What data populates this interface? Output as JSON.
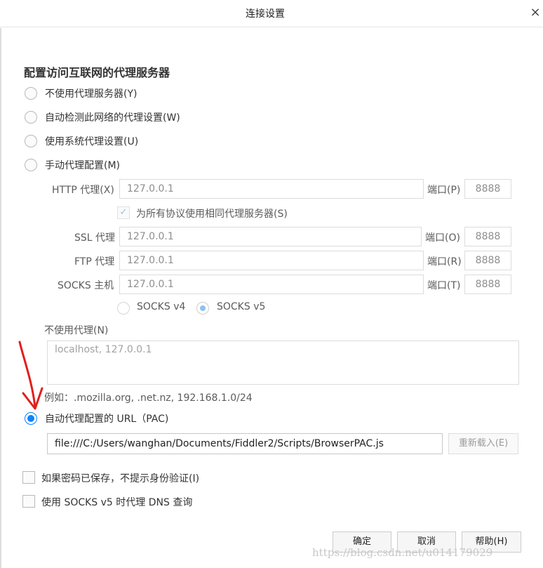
{
  "window": {
    "title": "连接设置",
    "close_glyph": "×"
  },
  "section_title": "配置访问互联网的代理服务器",
  "proxy_options": [
    {
      "label": "不使用代理服务器(Y)",
      "selected": false
    },
    {
      "label": "自动检测此网络的代理设置(W)",
      "selected": false
    },
    {
      "label": "使用系统代理设置(U)",
      "selected": false
    },
    {
      "label": "手动代理配置(M)",
      "selected": false
    },
    {
      "label": "自动代理配置的 URL（PAC)",
      "selected": true
    }
  ],
  "manual": {
    "http": {
      "label": "HTTP 代理(X)",
      "value": "127.0.0.1",
      "port_label": "端口(P)",
      "port": "8888"
    },
    "same_for_all": {
      "label": "为所有协议使用相同代理服务器(S)",
      "checked": true
    },
    "ssl": {
      "label": "SSL 代理",
      "value": "127.0.0.1",
      "port_label": "端口(O)",
      "port": "8888"
    },
    "ftp": {
      "label": "FTP 代理",
      "value": "127.0.0.1",
      "port_label": "端口(R)",
      "port": "8888"
    },
    "socks": {
      "label": "SOCKS 主机",
      "value": "127.0.0.1",
      "port_label": "端口(T)",
      "port": "8888"
    },
    "socks_v4": {
      "label": "SOCKS v4",
      "selected": false
    },
    "socks_v5": {
      "label": "SOCKS v5",
      "selected": true
    }
  },
  "no_proxy": {
    "label": "不使用代理(N)",
    "value": "localhost, 127.0.0.1",
    "example": "例如：.mozilla.org, .net.nz, 192.168.1.0/24"
  },
  "pac": {
    "url": "file:///C:/Users/wanghan/Documents/Fiddler2/Scripts/BrowserPAC.js",
    "reload_label": "重新载入(E)"
  },
  "options": [
    {
      "label": "如果密码已保存，不提示身份验证(I)",
      "checked": false
    },
    {
      "label": "使用 SOCKS v5 时代理 DNS 查询",
      "checked": false
    }
  ],
  "buttons": {
    "ok": "确定",
    "cancel": "取消",
    "help": "帮助(H)"
  },
  "watermark": "https://blog.csdn.net/u014179029",
  "colors": {
    "accent": "#0a84ff",
    "annotation_arrow": "#e0201c"
  }
}
